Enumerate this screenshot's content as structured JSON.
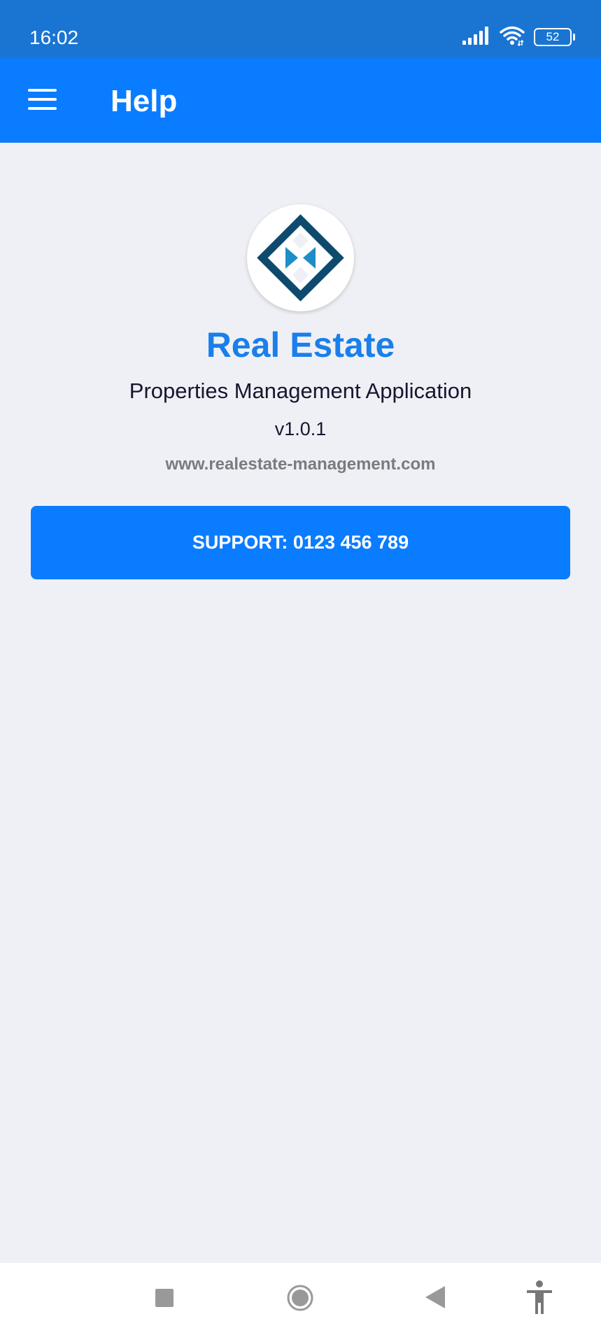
{
  "status_bar": {
    "time": "16:02",
    "battery_level": "52",
    "icons": [
      "signal-icon",
      "wifi-icon",
      "battery-icon"
    ]
  },
  "app_bar": {
    "title": "Help",
    "menu_icon": "hamburger-menu-icon"
  },
  "about": {
    "logo_icon": "real-estate-logo-icon",
    "app_name": "Real Estate",
    "subtitle": "Properties Management Application",
    "version": "v1.0.1",
    "website": "www.realestate-management.com"
  },
  "support_button": {
    "label": "SUPPORT: 0123 456 789"
  },
  "nav_bar": {
    "buttons": [
      "recent-apps-icon",
      "home-icon",
      "back-icon",
      "accessibility-icon"
    ]
  },
  "colors": {
    "status_bar": "#1a75d2",
    "app_bar": "#0a7cff",
    "background": "#eff0f5",
    "app_name": "#1a7fea",
    "logo_dark": "#0d4a6e",
    "logo_accent": "#1d8fc7"
  }
}
